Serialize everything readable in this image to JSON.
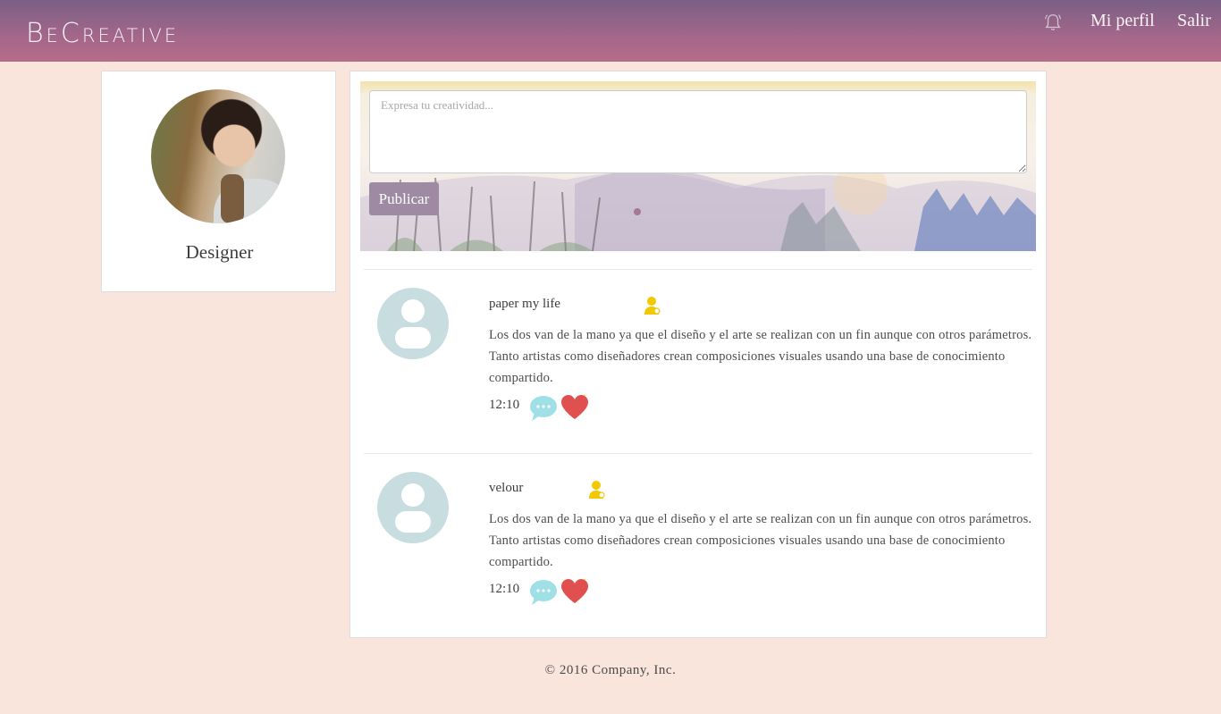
{
  "brand": {
    "name": "BeCreative"
  },
  "nav": {
    "profile_label": "Mi perfil",
    "logout_label": "Salir"
  },
  "profile": {
    "role": "Designer"
  },
  "composer": {
    "placeholder": "Expresa tu creatividad...",
    "publish_label": "Publicar"
  },
  "posts": [
    {
      "author": "paper my life",
      "text": "Los dos van de la mano ya que el diseño y el arte se realizan con un fin aunque con otros parámetros. Tanto artistas como diseñadores crean composiciones visuales usando una base de conocimiento compartido.",
      "time": "12:10"
    },
    {
      "author": "velour",
      "text": "Los dos van de la mano ya que el diseño y el arte se realizan con un fin aunque con otros parámetros. Tanto artistas como diseñadores crean composiciones visuales usando una base de conocimiento compartido.",
      "time": "12:10"
    }
  ],
  "footer": {
    "copyright": "© 2016 Company, Inc."
  },
  "colors": {
    "background": "#fae5dd",
    "header_start": "#7a5f86",
    "header_end": "#b56c88",
    "publish_button": "#9e8aa2",
    "avatar_placeholder": "#c7dde0",
    "badge": "#f2c800",
    "comment_icon": "#9fe0e6",
    "like_icon": "#e0504f"
  },
  "icons": {
    "bell": "bell-icon",
    "user_badge": "user-badge-icon",
    "comment": "comment-bubble-icon",
    "like": "heart-icon"
  }
}
